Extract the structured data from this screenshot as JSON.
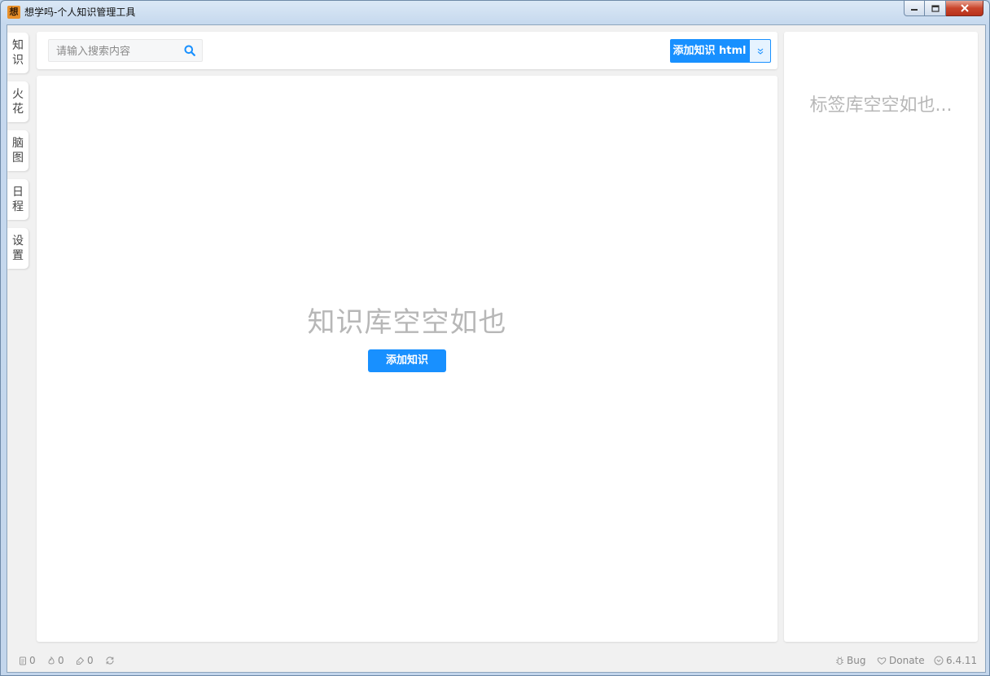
{
  "window": {
    "title": "想学吗-个人知识管理工具",
    "icon": "app-logo-icon"
  },
  "sidebar": {
    "tabs": [
      {
        "label_top": "知",
        "label_bottom": "识"
      },
      {
        "label_top": "火",
        "label_bottom": "花"
      },
      {
        "label_top": "脑",
        "label_bottom": "图"
      },
      {
        "label_top": "日",
        "label_bottom": "程"
      },
      {
        "label_top": "设",
        "label_bottom": "置"
      }
    ]
  },
  "toolbar": {
    "search_placeholder": "请输入搜索内容",
    "add_button_label": "添加知识 html",
    "dropdown_icon": "double-chevron-down-icon"
  },
  "main": {
    "empty_text": "知识库空空如也",
    "add_button_label": "添加知识"
  },
  "tags_panel": {
    "empty_text": "标签库空空如也..."
  },
  "statusbar": {
    "knowledge_count": "0",
    "spark_count": "0",
    "tag_count": "0",
    "bug_label": "Bug",
    "donate_label": "Donate",
    "version": "6.4.11"
  },
  "colors": {
    "accent": "#1890ff",
    "placeholder_text": "#b7b7b7"
  }
}
